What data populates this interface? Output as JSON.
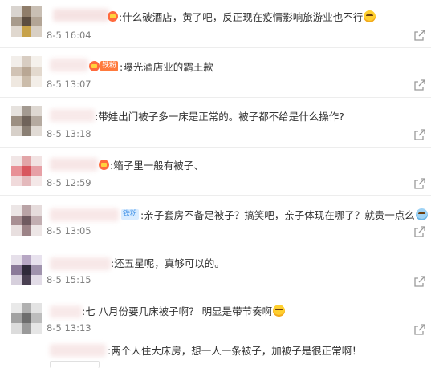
{
  "comments": [
    {
      "text": ":什么破酒店，黄了吧，反正现在疫情影响旅游业也不行",
      "time": "8-5 16:04",
      "badge": "vip",
      "emoji": true
    },
    {
      "text": ":曝光酒店业的霸王款",
      "time": "8-5 13:07",
      "badge": "vip+iron",
      "badge_label": "铁粉",
      "emoji": false
    },
    {
      "text": ":带娃出门被子多一床是正常的。被子都不给是什么操作?",
      "time": "8-5 13:18",
      "badge": "none",
      "emoji": false
    },
    {
      "text": ":箱子里一般有被子、",
      "time": "8-5 12:59",
      "badge": "vip",
      "emoji": false
    },
    {
      "text": ":亲子套房不备足被子？搞笑吧，亲子体现在哪了？就贵一点么",
      "time": "8-5 13:05",
      "badge": "iron",
      "badge_label": "铁粉",
      "emoji": true
    },
    {
      "text": ":还五星呢，真够可以的。",
      "time": "8-5 15:15",
      "badge": "none",
      "emoji": false
    },
    {
      "text": ":七 八月份要几床被子啊？ 明显是带节奏啊",
      "time": "8-5 13:13",
      "badge": "none",
      "emoji": true
    },
    {
      "text": ":两个人住大床房，想一人一条被子，加被子是很正常啊！",
      "time": "",
      "badge": "none",
      "emoji": false
    }
  ],
  "icons": {
    "share": "share-icon",
    "vip": "vip-crown-icon",
    "emoji": "emoji-icon"
  },
  "colors": {
    "text": "#333333",
    "time": "#808080",
    "iron_badge_bg": "#d9ecff",
    "iron_badge_text": "#3a8ee6",
    "vip_badge": "#ff6a3d"
  }
}
